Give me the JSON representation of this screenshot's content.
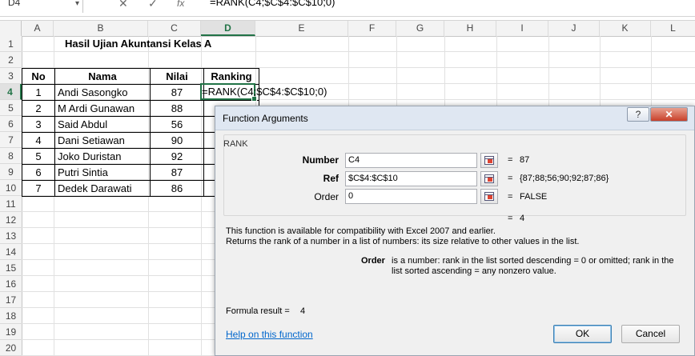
{
  "formula_bar": {
    "name_box": "D4",
    "cancel_icon": "x-icon",
    "enter_icon": "check-icon",
    "fx_label": "fx",
    "formula": "=RANK(C4;$C$4:$C$10;0)"
  },
  "columns": [
    "A",
    "B",
    "C",
    "D",
    "E",
    "F",
    "G",
    "H",
    "I",
    "J",
    "K",
    "L"
  ],
  "rows": [
    "1",
    "2",
    "3",
    "4",
    "5",
    "6",
    "7",
    "8",
    "9",
    "10",
    "11",
    "12",
    "13",
    "14",
    "15",
    "16",
    "17",
    "18",
    "19",
    "20"
  ],
  "sheet": {
    "title": "Hasil  Ujian Akuntansi Kelas A",
    "headers": {
      "no": "No",
      "nama": "Nama",
      "nilai": "Nilai",
      "ranking": "Ranking"
    },
    "records": [
      {
        "no": "1",
        "nama": "Andi Sasongko",
        "nilai": "87"
      },
      {
        "no": "2",
        "nama": "M Ardi Gunawan",
        "nilai": "88"
      },
      {
        "no": "3",
        "nama": "Said Abdul",
        "nilai": "56"
      },
      {
        "no": "4",
        "nama": "Dani Setiawan",
        "nilai": "90"
      },
      {
        "no": "5",
        "nama": "Joko Duristan",
        "nilai": "92"
      },
      {
        "no": "6",
        "nama": "Putri Sintia",
        "nilai": "87"
      },
      {
        "no": "7",
        "nama": "Dedek Darawati",
        "nilai": "86"
      }
    ],
    "active_cell_text": "=RANK(C4;$C$4:$C$10;0)"
  },
  "dialog": {
    "title": "Function Arguments",
    "help_btn": "?",
    "close_btn": "✕",
    "function_name": "RANK",
    "args": [
      {
        "label": "Number",
        "value": "C4",
        "result": "87"
      },
      {
        "label": "Ref",
        "value": "$C$4:$C$10",
        "result": "{87;88;56;90;92;87;86}"
      },
      {
        "label": "Order",
        "value": "0",
        "result": "FALSE"
      }
    ],
    "equals": "=",
    "overall_result": "4",
    "desc_line1": "This function is available for compatibility with Excel 2007 and earlier.",
    "desc_line2": "Returns the rank of a number in a list of numbers: its size relative to other values in the list.",
    "arg_desc_label": "Order",
    "arg_desc_text": "is a number: rank in the list sorted descending = 0 or omitted; rank in the list sorted ascending = any nonzero value.",
    "formula_result_label": "Formula result =",
    "formula_result_value": "4",
    "help_link": "Help on this function",
    "ok": "OK",
    "cancel": "Cancel"
  },
  "colors": {
    "accent": "#217346",
    "link": "#0066cc"
  }
}
